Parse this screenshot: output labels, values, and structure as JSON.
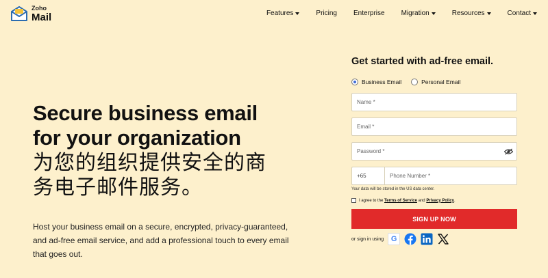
{
  "logo": {
    "brand": "Zoho",
    "product": "Mail"
  },
  "nav": [
    {
      "label": "Features",
      "dropdown": true
    },
    {
      "label": "Pricing",
      "dropdown": false
    },
    {
      "label": "Enterprise",
      "dropdown": false
    },
    {
      "label": "Migration",
      "dropdown": true
    },
    {
      "label": "Resources",
      "dropdown": true
    },
    {
      "label": "Contact",
      "dropdown": true
    }
  ],
  "hero": {
    "line1": "Secure business email",
    "line2": "for your organization",
    "cn_line1": "为您的组织提供安全的商",
    "cn_line2": "务电子邮件服务。",
    "description": "Host your business email on a secure, encrypted, privacy-guaranteed, and ad-free email service, and add a professional touch to every email that goes out."
  },
  "form": {
    "title": "Get started with ad-free email.",
    "radio_business": "Business Email",
    "radio_personal": "Personal Email",
    "selected": "business",
    "name_placeholder": "Name *",
    "email_placeholder": "Email *",
    "password_placeholder": "Password *",
    "country_code": "+65",
    "phone_placeholder": "Phone Number *",
    "data_note": "Your data will be stored in the US data center.",
    "agree_prefix": "I agree to the",
    "terms": "Terms of Service",
    "and": "and",
    "privacy": "Privacy Policy",
    "period": ".",
    "signup_label": "SIGN UP NOW",
    "signin_label": "or sign in using"
  },
  "social": [
    "google-icon",
    "facebook-icon",
    "linkedin-icon",
    "x-icon"
  ],
  "colors": {
    "background": "#fdf0cc",
    "accent": "#e12a2a",
    "facebook": "#1877f2",
    "linkedin": "#0a66c2"
  }
}
